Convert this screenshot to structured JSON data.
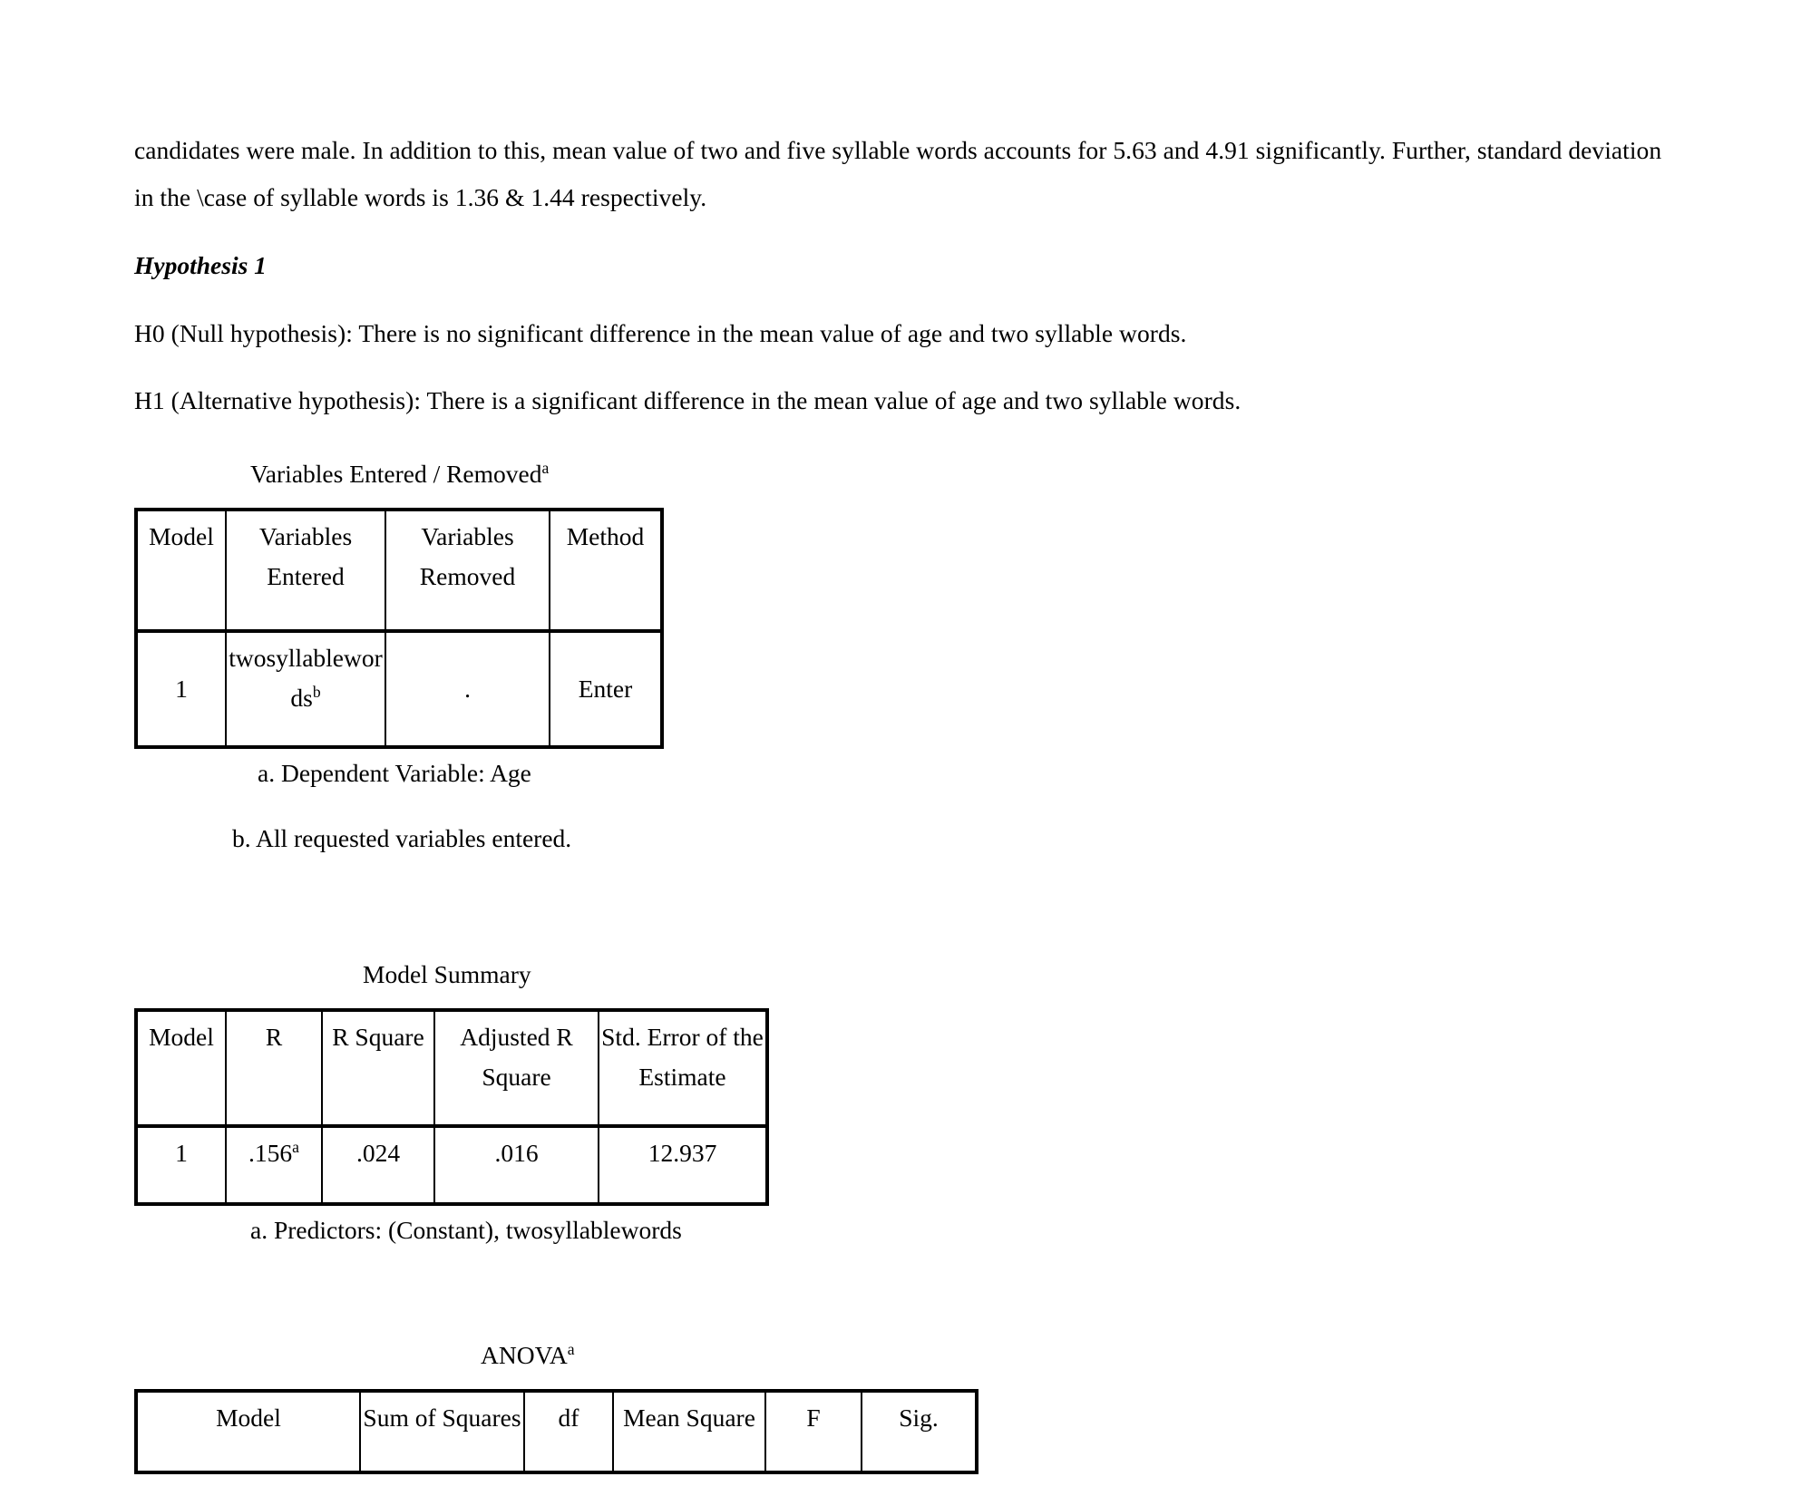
{
  "document": {
    "paragraphs": [
      "candidates were male. In addition to this, mean value of two and five syllable words accounts for 5.63 and 4.91 significantly. Further, standard deviation in the \\case of syllable words is 1.36 & 1.44 respectively.",
      "H0 (Null hypothesis): There is no significant difference in the mean value of age and two syllable words.",
      "H1 (Alternative hypothesis): There is a significant difference in the mean value of age and two syllable words."
    ],
    "heading": "Hypothesis 1"
  },
  "variables_table": {
    "caption": "Variables Entered / Removed",
    "caption_superscript": "a",
    "headers": [
      "Model",
      "Variables Entered",
      "Variables Removed",
      "Method"
    ],
    "header_lines": [
      [
        "Model"
      ],
      [
        "Variables",
        "Entered"
      ],
      [
        "Variables",
        "Removed"
      ],
      [
        "Method"
      ]
    ],
    "rows": [
      {
        "model": "1",
        "variables_entered": "twosyllablewords",
        "variables_entered_superscript": "b",
        "variables_removed": ".",
        "method": "Enter"
      }
    ],
    "notes": [
      "a. Dependent Variable: Age",
      "b. All requested variables entered."
    ]
  },
  "model_summary_table": {
    "caption": "Model Summary",
    "header_lines": [
      [
        "Model"
      ],
      [
        "R"
      ],
      [
        "R Square"
      ],
      [
        "Adjusted R",
        "Square"
      ],
      [
        "Std. Error of the",
        "Estimate"
      ]
    ],
    "rows": [
      {
        "model": "1",
        "r": ".156",
        "r_superscript": "a",
        "r_square": ".024",
        "adjusted_r_square": ".016",
        "std_error_of_the_estimate": "12.937"
      }
    ],
    "notes": [
      "a. Predictors: (Constant), twosyllablewords"
    ]
  },
  "anova_table": {
    "caption": "ANOVA",
    "caption_superscript": "a",
    "headers": [
      "Model",
      "Sum of Squares",
      "df",
      "Mean Square",
      "F",
      "Sig."
    ],
    "rows": []
  }
}
